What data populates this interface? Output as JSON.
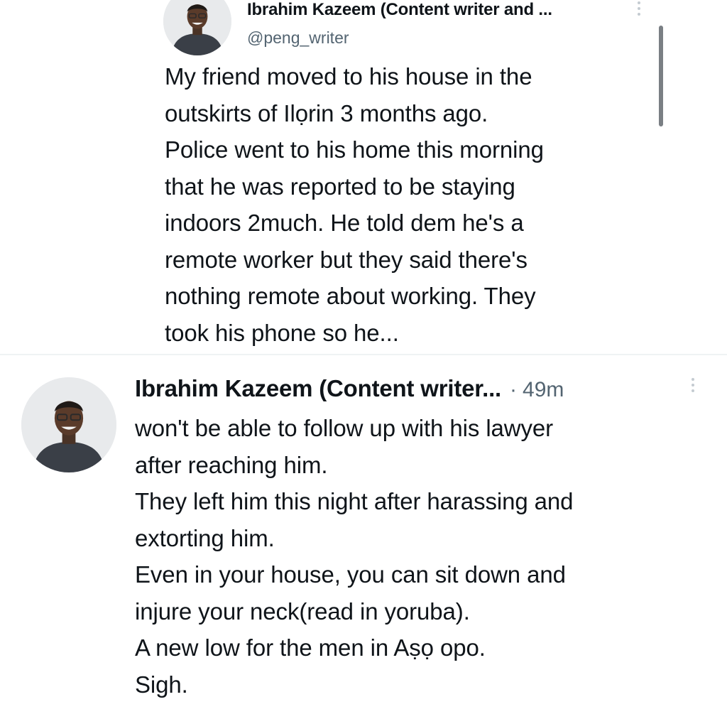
{
  "tweet_top": {
    "author_name": "Ibrahim Kazeem (Content writer and ...",
    "handle": "@peng_writer",
    "text": "My friend moved to his house in the\noutskirts of Ilọrin 3 months ago.\nPolice went to his home this morning\nthat he was reported to be staying\nindoors 2much. He told dem he's a\nremote worker but they said there's\nnothing remote about working. They\ntook his phone so he..."
  },
  "tweet_bottom": {
    "author_name": "Ibrahim Kazeem (Content writer...",
    "separator": "·",
    "timestamp": "49m",
    "lines": [
      "won't be able to follow up with his lawyer",
      "after reaching him.",
      "They left him this night after harassing and",
      "extorting him.",
      "Even in your house, you can sit down and",
      "injure your neck(read in yoruba).",
      "A new low for the men in Aṣọ opo.",
      "Sigh."
    ]
  },
  "colors": {
    "text": "#0f1419",
    "secondary_text": "#536471",
    "divider": "#eff3f4",
    "more_icon": "#c4cbd1"
  },
  "icons": {
    "avatar": "profile-photo",
    "more": "vertical-ellipsis-icon"
  }
}
